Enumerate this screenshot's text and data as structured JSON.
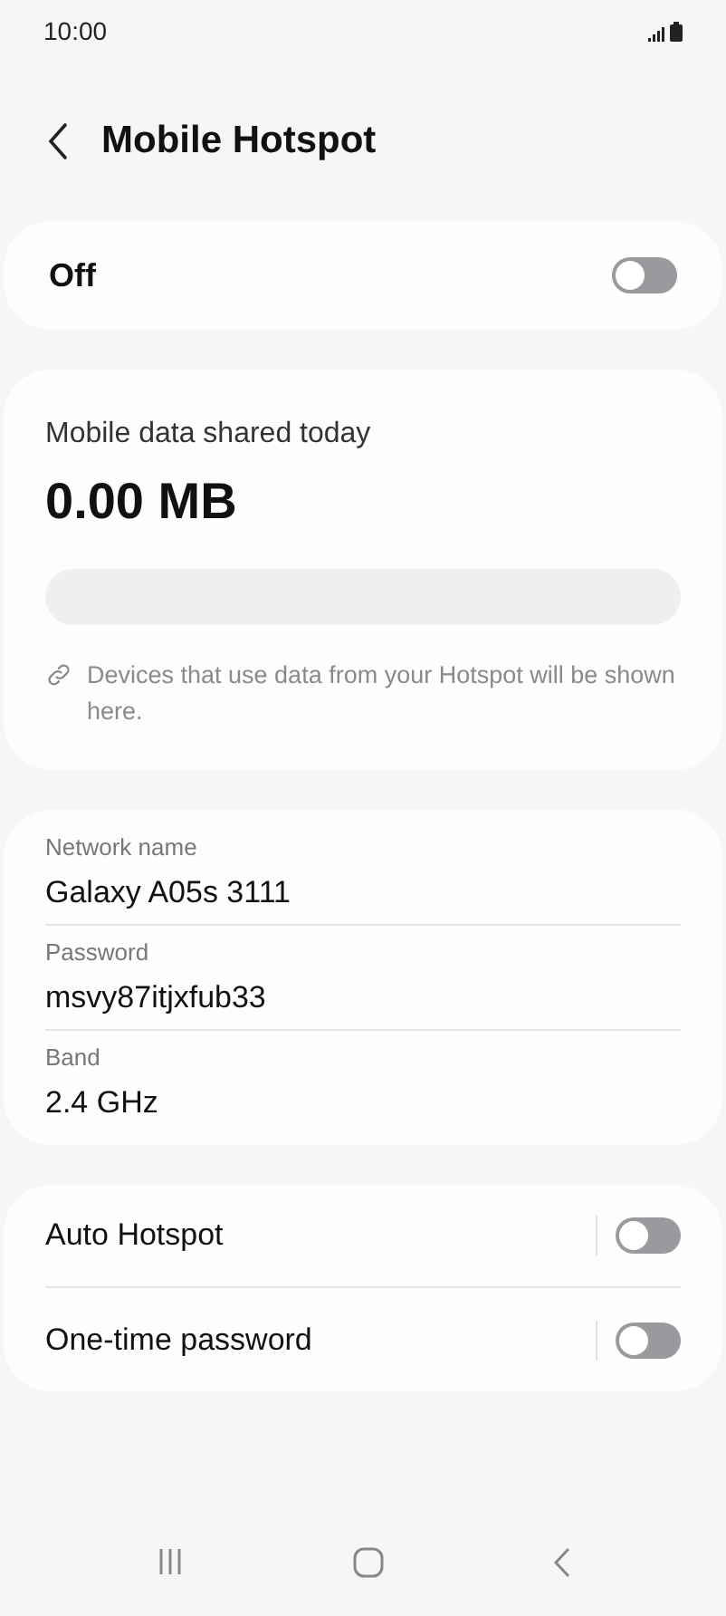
{
  "status_bar": {
    "time": "10:00"
  },
  "header": {
    "title": "Mobile Hotspot"
  },
  "master_switch": {
    "label": "Off",
    "on": false
  },
  "usage": {
    "label": "Mobile data shared today",
    "amount": "0.00 MB",
    "level": 0,
    "note": "Devices that use data from your Hotspot will be shown here."
  },
  "network_fields": [
    {
      "label": "Network name",
      "value": "Galaxy A05s 3111"
    },
    {
      "label": "Password",
      "value": "msvy87itjxfub33"
    },
    {
      "label": "Band",
      "value": "2.4 GHz"
    }
  ],
  "options": [
    {
      "label": "Auto Hotspot",
      "on": false
    },
    {
      "label": "One-time password",
      "on": false
    }
  ]
}
